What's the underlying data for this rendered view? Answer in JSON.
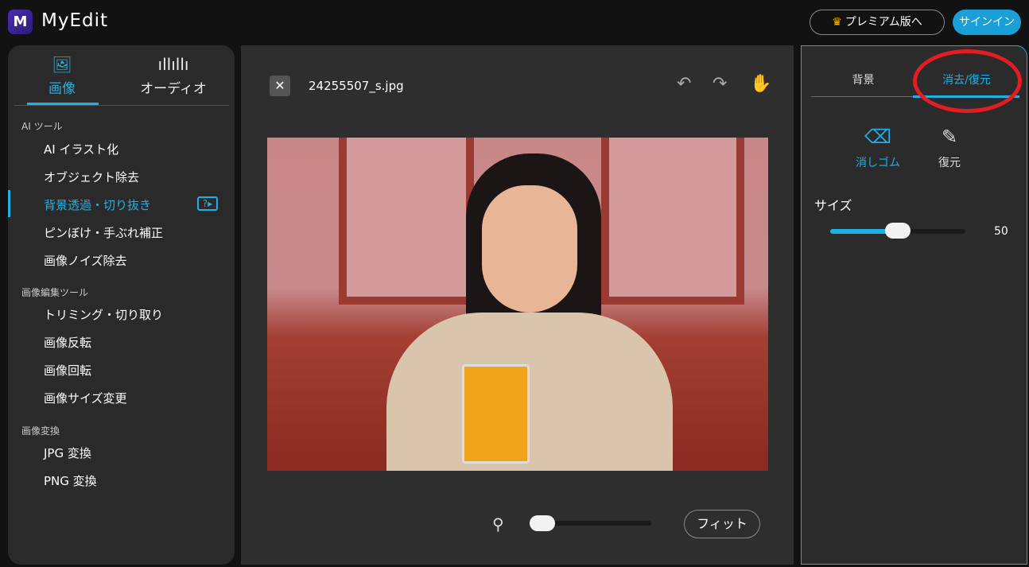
{
  "header": {
    "logo_letter": "M",
    "brand": "MyEdit",
    "premium": "プレミアム版へ",
    "signin": "サインイン"
  },
  "left": {
    "tabs": [
      {
        "label": "画像",
        "icon": "image-icon"
      },
      {
        "label": "オーディオ",
        "icon": "audio-wave-icon"
      }
    ],
    "sections": [
      {
        "title": "AI ツール",
        "items": [
          "AI イラスト化",
          "オブジェクト除去",
          "背景透過・切り抜き",
          "ピンぼけ・手ぶれ補正",
          "画像ノイズ除去"
        ]
      },
      {
        "title": "画像編集ツール",
        "items": [
          "トリミング・切り取り",
          "画像反転",
          "画像回転",
          "画像サイズ変更"
        ]
      },
      {
        "title": "画像変換",
        "items": [
          "JPG 変換",
          "PNG 変換"
        ]
      }
    ],
    "active_item": "背景透過・切り抜き"
  },
  "center": {
    "filename": "24255507_s.jpg",
    "fit": "フィット",
    "zoom_percent": 0
  },
  "right": {
    "tabs": [
      "背景",
      "消去/復元"
    ],
    "active_tab": "消去/復元",
    "modes": [
      {
        "label": "消しゴム",
        "active": true
      },
      {
        "label": "復元",
        "active": false
      }
    ],
    "size_label": "サイズ",
    "size_value": "50",
    "size_fraction": 0.5
  },
  "colors": {
    "accent": "#1fb0e6",
    "highlight_ring": "#e41c24"
  }
}
